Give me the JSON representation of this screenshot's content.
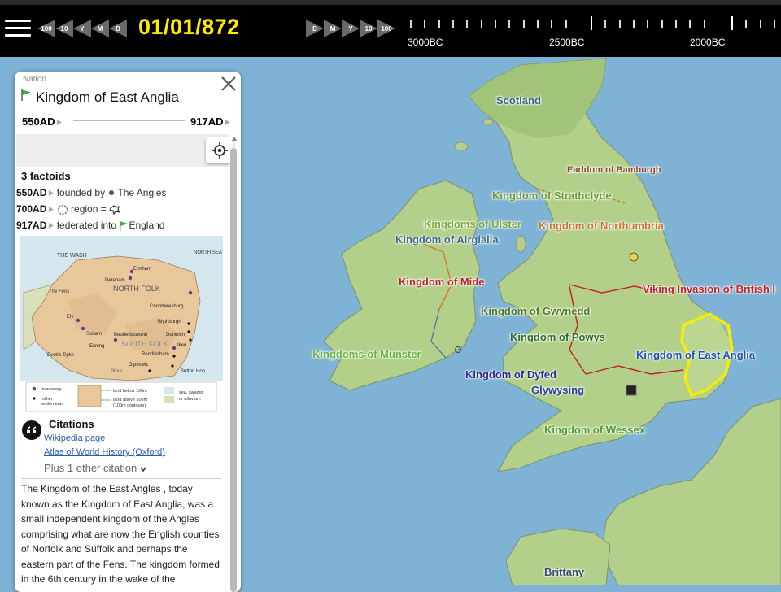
{
  "toolbar": {
    "back_buttons": [
      "100",
      "10",
      "Y",
      "M",
      "D"
    ],
    "current_date": "01/01/872",
    "forward_buttons": [
      "D",
      "M",
      "Y",
      "10",
      "100"
    ]
  },
  "timeline": {
    "labels": [
      "3000BC",
      "2500BC",
      "2000BC"
    ]
  },
  "colors": {
    "toolbar_bg": "#000000",
    "date_yellow": "#ffeb00",
    "sea": "#7fb3d5",
    "land_green": "#a9cf83",
    "highlight_yellow": "#f5ee00",
    "link_blue": "#2a5db0"
  },
  "panel": {
    "type_label": "Nation",
    "flag_icon": "green-flag-icon",
    "title": "Kingdom of East Anglia",
    "start": "550AD",
    "end": "917AD",
    "factoids_title": "3 factoids",
    "factoids": [
      {
        "date": "550AD",
        "text": "founded by",
        "target": "The Angles"
      },
      {
        "date": "700AD",
        "text": "region =",
        "target": ""
      },
      {
        "date": "917AD",
        "text": "federated into",
        "target": "England"
      }
    ],
    "map_image": {
      "the_wash": "THE WASH",
      "north_sea": "NORTH SEA",
      "the_fens": "The Fens",
      "north_folk": "NORTH FOLK",
      "south_folk": "SOUTH FOLK",
      "elmham": "Elmham",
      "dereham": "Dereham",
      "cnobheresburg": "Cnobheresburg",
      "blythburgh": "Blythburgh",
      "dunwich": "Dunwich",
      "ely": "Ely",
      "soham": "Soham",
      "beodericsworth": "Beodericsworth",
      "exning": "Exning",
      "iken": "Iken",
      "rendlesham": "Rendlesham",
      "devils_dyke": "Devil's Dyke",
      "gipeswic": "Gipeswic",
      "sutton_hoo": "Sutton Hoo",
      "stour": "Stour",
      "legend_monastery": "monastery",
      "legend_other": "other",
      "legend_settlements": "settlements",
      "legend_below": "land below 100m",
      "legend_above": "land above 100m",
      "legend_contours": "(100m contours)",
      "legend_sea": "sea, swamp",
      "legend_alluvium": "or alluvium"
    },
    "citations_title": "Citations",
    "citations": [
      "Wikipedia page",
      "Atlas of World History (Oxford)"
    ],
    "more_citations": "Plus 1 other citation",
    "description": "The Kingdom of the East Angles , today known as the Kingdom of East Anglia, was a small independent kingdom of the Angles comprising what are now the English counties of Norfolk and Suffolk and perhaps the eastern part of the Fens. The kingdom formed in the 6th century in the wake of the"
  },
  "map_labels": [
    {
      "text": "Scotland",
      "color": "#3b5f8a"
    },
    {
      "text": "Earldom of Bamburgh",
      "color": "#8a4a2a"
    },
    {
      "text": "Kingdom of Strathclyde",
      "color": "#6a9a30"
    },
    {
      "text": "Kingdoms of Ulster",
      "color": "#7aa83a"
    },
    {
      "text": "Kingdom of Northumbria",
      "color": "#c8742c"
    },
    {
      "text": "Kingdom of Airgialla",
      "color": "#3e6a8a"
    },
    {
      "text": "Kingdom of Mide",
      "color": "#c0202a"
    },
    {
      "text": "Viking Invasion of British I",
      "color": "#c0202a"
    },
    {
      "text": "Kingdom of Gwynedd",
      "color": "#4e7a20"
    },
    {
      "text": "Kingdom of Powys",
      "color": "#2e6a2a"
    },
    {
      "text": "Kingdom of East Anglia",
      "color": "#2050c0"
    },
    {
      "text": "Kingdoms of Munster",
      "color": "#6ab23a"
    },
    {
      "text": "Kingdom of Dyfed",
      "color": "#2a2a8a"
    },
    {
      "text": "Glywysing",
      "color": "#2a3a9a"
    },
    {
      "text": "Kingdom of Wessex",
      "color": "#4e9a30"
    },
    {
      "text": "Brittany",
      "color": "#3a4a6a"
    }
  ]
}
